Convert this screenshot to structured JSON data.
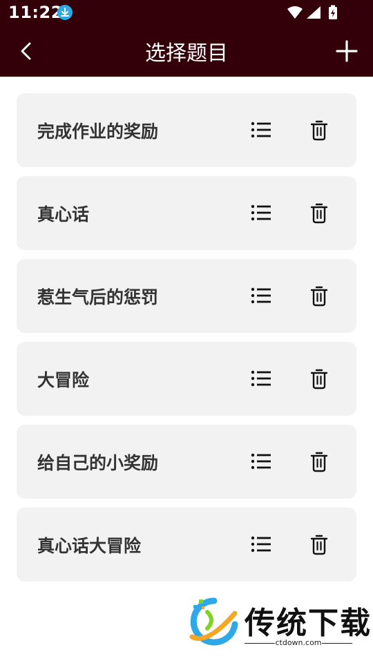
{
  "status_bar": {
    "time": "11:22",
    "icons": [
      "download-icon",
      "wifi-icon",
      "signal-icon",
      "battery-icon"
    ]
  },
  "toolbar": {
    "title": "选择题目",
    "back_icon": "chevron-left-icon",
    "add_icon": "plus-icon"
  },
  "topics": [
    {
      "label": "完成作业的奖励"
    },
    {
      "label": "真心话"
    },
    {
      "label": "惹生气后的惩罚"
    },
    {
      "label": "大冒险"
    },
    {
      "label": "给自己的小奖励"
    },
    {
      "label": "真心话大冒险"
    }
  ],
  "watermark": {
    "text": "传统下载",
    "url": "ctdown.com"
  },
  "colors": {
    "header_bg": "#33000a",
    "card_bg": "#f2f2f2",
    "download_badge": "#2ea8e6"
  }
}
